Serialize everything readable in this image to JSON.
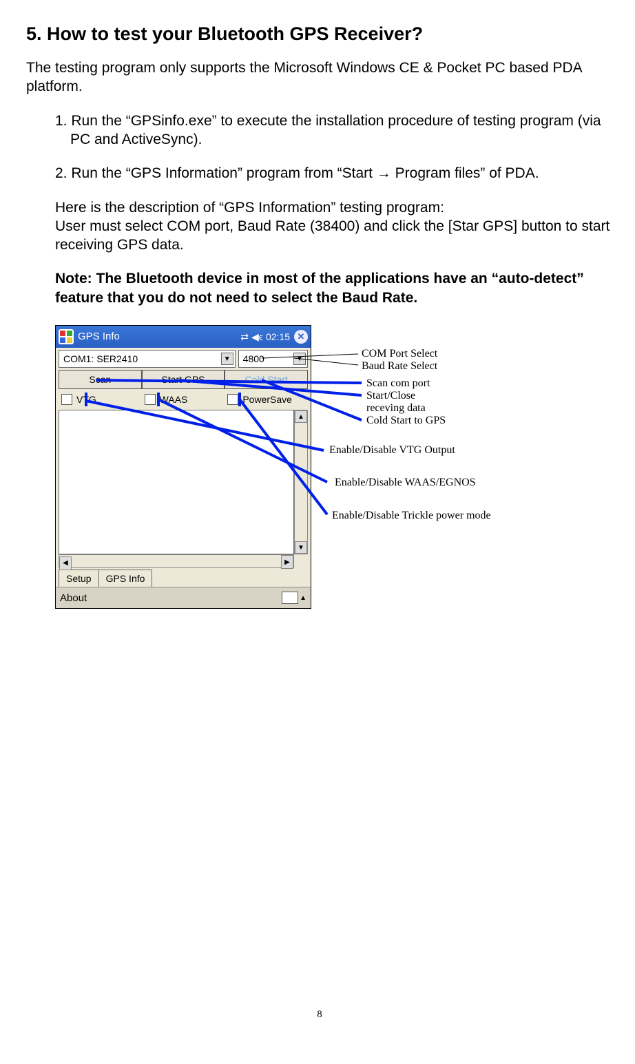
{
  "heading": "5.  How to test your Bluetooth GPS Receiver?",
  "intro": "The testing program only supports the Microsoft Windows CE & Pocket PC based PDA platform.",
  "step1": "1. Run the “GPSinfo.exe” to execute the installation procedure of testing program (via PC and ActiveSync).",
  "step2": "2. Run the “GPS Information” program from “Start → Program files” of PDA.",
  "desc1": "Here is the description of “GPS Information” testing program:",
  "desc2": "User must select COM port, Baud Rate (38400) and click the [Star GPS] button to start receiving GPS data.",
  "note": "Note: The Bluetooth device in most of the applications have an “auto-detect” feature that you do not need to select the Baud Rate.",
  "pda": {
    "title": "GPS Info",
    "time": "02:15",
    "com_port": "COM1: SER2410",
    "baud": "4800",
    "buttons": {
      "scan": "Scan",
      "start": "Start GPS",
      "cold": "Cold Start"
    },
    "checks": {
      "vtg": "VTG",
      "waas": "WAAS",
      "powersave": "PowerSave"
    },
    "tabs": {
      "setup": "Setup",
      "gpsinfo": "GPS Info"
    },
    "about": "About"
  },
  "annotations": {
    "com_port": "COM Port Select",
    "baud": "Baud Rate Select",
    "scan": "Scan com port",
    "start": "Start/Close receving data",
    "cold": "Cold Start to GPS",
    "vtg": "Enable/Disable VTG Output",
    "waas": "Enable/Disable WAAS/EGNOS",
    "powersave": "Enable/Disable Trickle power mode"
  },
  "page_number": "8"
}
